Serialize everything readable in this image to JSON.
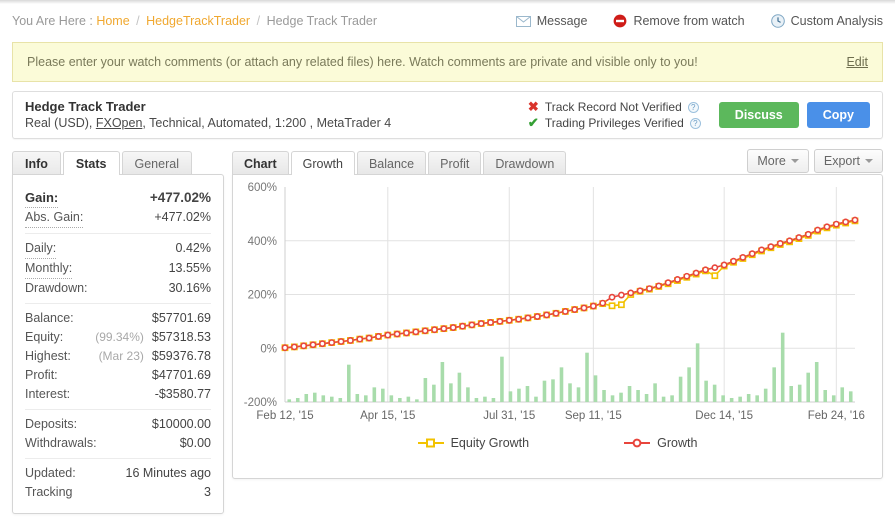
{
  "breadcrumb": {
    "prefix": "You Are Here :",
    "home": "Home",
    "sep": "/",
    "account": "HedgeTrackTrader",
    "current": "Hedge Track Trader"
  },
  "header_actions": [
    {
      "label": "Message",
      "icon": "envelope-icon"
    },
    {
      "label": "Remove from watch",
      "icon": "remove-circle-icon"
    },
    {
      "label": "Custom Analysis",
      "icon": "clock-icon"
    }
  ],
  "notice": {
    "text": "Please enter your watch comments (or attach any related files) here. Watch comments are private and visible only to you!",
    "edit_label": "Edit",
    "bg": "#fbfbd8",
    "border": "#e8e3a8"
  },
  "account": {
    "name": "Hedge Track Trader",
    "details_pre": "Real (USD), ",
    "broker": "FXOpen",
    "details_post": ", Technical, Automated, 1:200 , MetaTrader 4",
    "verification": [
      {
        "status": "not-verified",
        "mark": "✖",
        "label": "Track Record Not Verified",
        "info": "?"
      },
      {
        "status": "verified",
        "mark": "✔",
        "label": "Trading Privileges Verified",
        "info": "?"
      }
    ],
    "discuss_label": "Discuss",
    "copy_label": "Copy",
    "discuss_color": "#5cb85c",
    "copy_color": "#4a90e8"
  },
  "info_panel": {
    "tabs": [
      {
        "label": "Info",
        "active": false,
        "title": true
      },
      {
        "label": "Stats",
        "active": true
      },
      {
        "label": "General",
        "active": false
      }
    ],
    "groups": [
      {
        "rows": [
          {
            "key": "Gain:",
            "value": "+477.02%",
            "accent": "green",
            "big": true,
            "dotted": true
          },
          {
            "key": "Abs. Gain:",
            "value": "+477.02%",
            "accent": "green",
            "dotted": true
          }
        ]
      },
      {
        "rows": [
          {
            "key": "Daily:",
            "value": "0.42%",
            "dotted": true
          },
          {
            "key": "Monthly:",
            "value": "13.55%",
            "dotted": true
          },
          {
            "key": "Drawdown:",
            "value": "30.16%",
            "dotted": false
          }
        ]
      },
      {
        "rows": [
          {
            "key": "Balance:",
            "value": "$57701.69"
          },
          {
            "key": "Equity:",
            "value": "$57318.53",
            "note": "(99.34%)"
          },
          {
            "key": "Highest:",
            "value": "$59376.78",
            "note": "(Mar 23)"
          },
          {
            "key": "Profit:",
            "value": "$47701.69",
            "accent": "green"
          },
          {
            "key": "Interest:",
            "value": "-$3580.77"
          }
        ]
      },
      {
        "rows": [
          {
            "key": "Deposits:",
            "value": "$10000.00"
          },
          {
            "key": "Withdrawals:",
            "value": "$0.00"
          }
        ]
      },
      {
        "rows": [
          {
            "key": "Updated:",
            "value": "16 Minutes ago"
          },
          {
            "key": "Tracking",
            "value": "3"
          }
        ]
      }
    ]
  },
  "chart_panel": {
    "title_tab": "Chart",
    "tabs": [
      {
        "label": "Growth",
        "active": true
      },
      {
        "label": "Balance",
        "active": false
      },
      {
        "label": "Profit",
        "active": false
      },
      {
        "label": "Drawdown",
        "active": false
      }
    ],
    "controls": [
      {
        "label": "More",
        "icon": "chevron-down-icon"
      },
      {
        "label": "Export",
        "icon": "chevron-down-icon"
      }
    ]
  },
  "chart_data": {
    "type": "line",
    "title": "Growth",
    "xlabel": "",
    "ylabel": "",
    "ylim": [
      -200,
      600
    ],
    "yticks": [
      600,
      400,
      200,
      0,
      -200
    ],
    "ytick_labels": [
      "600%",
      "400%",
      "200%",
      "0%",
      "-200%"
    ],
    "grid": true,
    "legend_position": "bottom",
    "xtick_labels": [
      "Feb 12, '15",
      "Apr 15, '15",
      "Jul 31, '15",
      "Sep 11, '15",
      "Dec 14, '15",
      "Feb 24, '16"
    ],
    "xtick_positions": [
      0,
      11,
      24,
      33,
      47,
      59
    ],
    "series": [
      {
        "name": "Growth",
        "color": "#e8453c",
        "marker_fill": "#ffffff",
        "values": [
          2,
          5,
          9,
          13,
          17,
          21,
          25,
          29,
          34,
          38,
          44,
          49,
          53,
          57,
          61,
          65,
          69,
          73,
          77,
          82,
          87,
          92,
          96,
          100,
          104,
          108,
          113,
          118,
          124,
          130,
          137,
          144,
          150,
          157,
          168,
          190,
          198,
          206,
          214,
          222,
          232,
          244,
          256,
          268,
          280,
          292,
          300,
          310,
          324,
          338,
          352,
          366,
          378,
          390,
          400,
          412,
          424,
          440,
          452,
          462,
          470,
          477
        ]
      },
      {
        "name": "Equity Growth",
        "color": "#f2c200",
        "marker_fill": "#ffffff",
        "values": [
          2,
          5,
          9,
          13,
          17,
          21,
          25,
          29,
          34,
          38,
          44,
          49,
          53,
          57,
          61,
          65,
          69,
          73,
          77,
          82,
          87,
          92,
          96,
          100,
          104,
          108,
          113,
          118,
          124,
          130,
          137,
          144,
          150,
          157,
          166,
          158,
          162,
          200,
          212,
          220,
          230,
          240,
          252,
          264,
          276,
          288,
          270,
          306,
          320,
          334,
          348,
          362,
          374,
          386,
          396,
          408,
          420,
          436,
          448,
          458,
          466,
          474
        ]
      }
    ],
    "bars": {
      "name": "Monthly Volume",
      "color": "#a8dcab",
      "baseline": -200,
      "values": [
        2,
        3,
        6,
        7,
        5,
        4,
        3,
        28,
        6,
        5,
        11,
        10,
        5,
        3,
        4,
        2,
        18,
        13,
        30,
        14,
        22,
        11,
        3,
        4,
        3,
        34,
        8,
        10,
        12,
        4,
        16,
        17,
        26,
        14,
        11,
        37,
        20,
        9,
        5,
        7,
        12,
        9,
        6,
        14,
        4,
        5,
        19,
        26,
        44,
        16,
        13,
        5,
        3,
        4,
        6,
        5,
        10,
        26,
        52,
        12,
        13,
        22,
        30,
        9,
        5,
        11,
        8
      ]
    },
    "legend": [
      {
        "label": "Equity Growth",
        "color": "#f2c200"
      },
      {
        "label": "Growth",
        "color": "#e8453c"
      }
    ]
  }
}
